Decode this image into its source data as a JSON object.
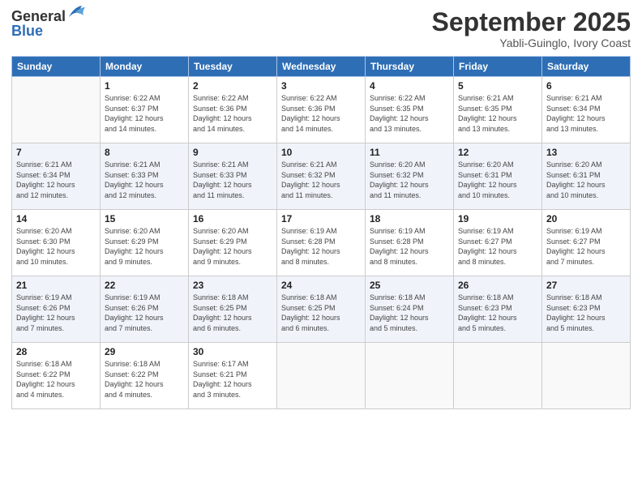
{
  "logo": {
    "line1": "General",
    "line2": "Blue"
  },
  "title": "September 2025",
  "subtitle": "Yabli-Guinglo, Ivory Coast",
  "days_header": [
    "Sunday",
    "Monday",
    "Tuesday",
    "Wednesday",
    "Thursday",
    "Friday",
    "Saturday"
  ],
  "weeks": [
    [
      {
        "num": "",
        "info": ""
      },
      {
        "num": "1",
        "info": "Sunrise: 6:22 AM\nSunset: 6:37 PM\nDaylight: 12 hours\nand 14 minutes."
      },
      {
        "num": "2",
        "info": "Sunrise: 6:22 AM\nSunset: 6:36 PM\nDaylight: 12 hours\nand 14 minutes."
      },
      {
        "num": "3",
        "info": "Sunrise: 6:22 AM\nSunset: 6:36 PM\nDaylight: 12 hours\nand 14 minutes."
      },
      {
        "num": "4",
        "info": "Sunrise: 6:22 AM\nSunset: 6:35 PM\nDaylight: 12 hours\nand 13 minutes."
      },
      {
        "num": "5",
        "info": "Sunrise: 6:21 AM\nSunset: 6:35 PM\nDaylight: 12 hours\nand 13 minutes."
      },
      {
        "num": "6",
        "info": "Sunrise: 6:21 AM\nSunset: 6:34 PM\nDaylight: 12 hours\nand 13 minutes."
      }
    ],
    [
      {
        "num": "7",
        "info": "Sunrise: 6:21 AM\nSunset: 6:34 PM\nDaylight: 12 hours\nand 12 minutes."
      },
      {
        "num": "8",
        "info": "Sunrise: 6:21 AM\nSunset: 6:33 PM\nDaylight: 12 hours\nand 12 minutes."
      },
      {
        "num": "9",
        "info": "Sunrise: 6:21 AM\nSunset: 6:33 PM\nDaylight: 12 hours\nand 11 minutes."
      },
      {
        "num": "10",
        "info": "Sunrise: 6:21 AM\nSunset: 6:32 PM\nDaylight: 12 hours\nand 11 minutes."
      },
      {
        "num": "11",
        "info": "Sunrise: 6:20 AM\nSunset: 6:32 PM\nDaylight: 12 hours\nand 11 minutes."
      },
      {
        "num": "12",
        "info": "Sunrise: 6:20 AM\nSunset: 6:31 PM\nDaylight: 12 hours\nand 10 minutes."
      },
      {
        "num": "13",
        "info": "Sunrise: 6:20 AM\nSunset: 6:31 PM\nDaylight: 12 hours\nand 10 minutes."
      }
    ],
    [
      {
        "num": "14",
        "info": "Sunrise: 6:20 AM\nSunset: 6:30 PM\nDaylight: 12 hours\nand 10 minutes."
      },
      {
        "num": "15",
        "info": "Sunrise: 6:20 AM\nSunset: 6:29 PM\nDaylight: 12 hours\nand 9 minutes."
      },
      {
        "num": "16",
        "info": "Sunrise: 6:20 AM\nSunset: 6:29 PM\nDaylight: 12 hours\nand 9 minutes."
      },
      {
        "num": "17",
        "info": "Sunrise: 6:19 AM\nSunset: 6:28 PM\nDaylight: 12 hours\nand 8 minutes."
      },
      {
        "num": "18",
        "info": "Sunrise: 6:19 AM\nSunset: 6:28 PM\nDaylight: 12 hours\nand 8 minutes."
      },
      {
        "num": "19",
        "info": "Sunrise: 6:19 AM\nSunset: 6:27 PM\nDaylight: 12 hours\nand 8 minutes."
      },
      {
        "num": "20",
        "info": "Sunrise: 6:19 AM\nSunset: 6:27 PM\nDaylight: 12 hours\nand 7 minutes."
      }
    ],
    [
      {
        "num": "21",
        "info": "Sunrise: 6:19 AM\nSunset: 6:26 PM\nDaylight: 12 hours\nand 7 minutes."
      },
      {
        "num": "22",
        "info": "Sunrise: 6:19 AM\nSunset: 6:26 PM\nDaylight: 12 hours\nand 7 minutes."
      },
      {
        "num": "23",
        "info": "Sunrise: 6:18 AM\nSunset: 6:25 PM\nDaylight: 12 hours\nand 6 minutes."
      },
      {
        "num": "24",
        "info": "Sunrise: 6:18 AM\nSunset: 6:25 PM\nDaylight: 12 hours\nand 6 minutes."
      },
      {
        "num": "25",
        "info": "Sunrise: 6:18 AM\nSunset: 6:24 PM\nDaylight: 12 hours\nand 5 minutes."
      },
      {
        "num": "26",
        "info": "Sunrise: 6:18 AM\nSunset: 6:23 PM\nDaylight: 12 hours\nand 5 minutes."
      },
      {
        "num": "27",
        "info": "Sunrise: 6:18 AM\nSunset: 6:23 PM\nDaylight: 12 hours\nand 5 minutes."
      }
    ],
    [
      {
        "num": "28",
        "info": "Sunrise: 6:18 AM\nSunset: 6:22 PM\nDaylight: 12 hours\nand 4 minutes."
      },
      {
        "num": "29",
        "info": "Sunrise: 6:18 AM\nSunset: 6:22 PM\nDaylight: 12 hours\nand 4 minutes."
      },
      {
        "num": "30",
        "info": "Sunrise: 6:17 AM\nSunset: 6:21 PM\nDaylight: 12 hours\nand 3 minutes."
      },
      {
        "num": "",
        "info": ""
      },
      {
        "num": "",
        "info": ""
      },
      {
        "num": "",
        "info": ""
      },
      {
        "num": "",
        "info": ""
      }
    ]
  ]
}
